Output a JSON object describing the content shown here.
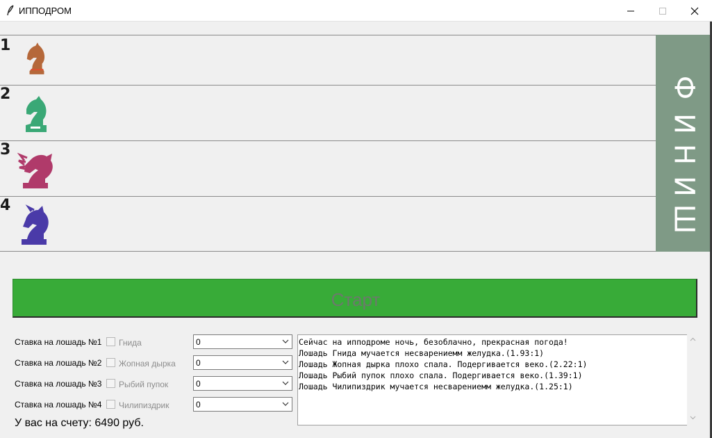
{
  "window": {
    "title": "ИППОДРОМ",
    "icon": "feather-icon",
    "controls": [
      "minimize-icon",
      "maximize-icon",
      "close-icon"
    ]
  },
  "track": {
    "lanes": [
      {
        "number": "1",
        "horse_color": "#b5683a",
        "horse_icon": "chess-knight-icon"
      },
      {
        "number": "2",
        "horse_color": "#3aa876",
        "horse_icon": "chess-knight-icon"
      },
      {
        "number": "3",
        "horse_color": "#b03a6a",
        "horse_icon": "chess-knight-icon"
      },
      {
        "number": "4",
        "horse_color": "#4a3aa8",
        "horse_icon": "chess-knight-icon"
      }
    ],
    "finish": {
      "letters": [
        "Ф",
        "И",
        "Н",
        "И",
        "Ш"
      ],
      "background": "#7f9a86"
    }
  },
  "start_button": {
    "label": "Старт",
    "background": "#38ab38"
  },
  "bets": [
    {
      "label": "Ставка на лошадь №1",
      "horse_name": "Гнида",
      "amount": "0"
    },
    {
      "label": "Ставка на лошадь №2",
      "horse_name": "Жопная дырка",
      "amount": "0"
    },
    {
      "label": "Ставка на лошадь №3",
      "horse_name": "Рыбий пупок",
      "amount": "0"
    },
    {
      "label": "Ставка на лошадь №4",
      "horse_name": "Чилипиздрик",
      "amount": "0"
    }
  ],
  "balance": "У вас на счету: 6490 руб.",
  "log": {
    "lines": [
      "Сейчас на ипподроме ночь, безоблачно, прекрасная погода!",
      "Лошадь Гнида мучается несварениемм желудка.(1.93:1)",
      "Лошадь Жопная дырка плохо спала. Подергивается веко.(2.22:1)",
      "Лошадь Рыбий пупок плохо спала. Подергивается веко.(1.39:1)",
      "Лошадь Чилипиздрик мучается несварениемм желудка.(1.25:1)"
    ]
  }
}
